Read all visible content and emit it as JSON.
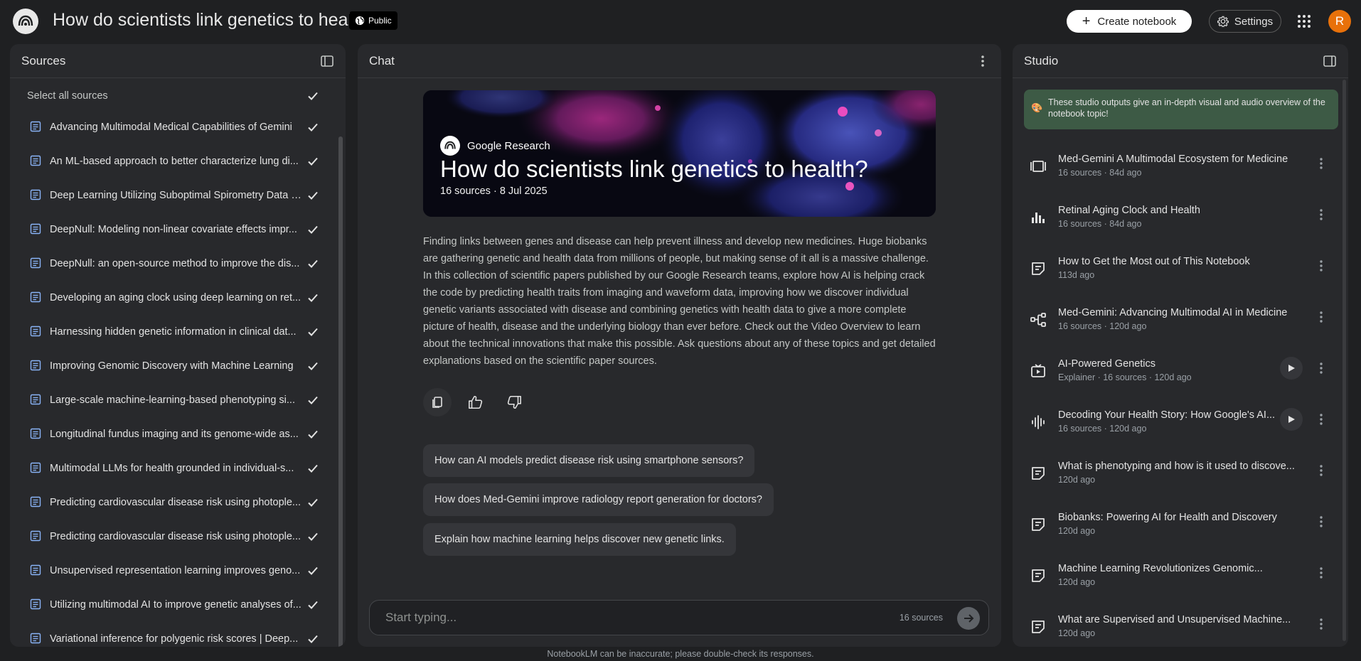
{
  "app": {
    "notebook_title": "How do scientists link genetics to health?",
    "public_label": "Public",
    "create_label": "Create notebook",
    "settings_label": "Settings",
    "avatar_initial": "R"
  },
  "sources": {
    "header": "Sources",
    "select_all": "Select all sources",
    "items": [
      "Advancing Multimodal Medical Capabilities of Gemini",
      "An ML-based approach to better characterize lung di...",
      "Deep Learning Utilizing Suboptimal Spirometry Data t...",
      "DeepNull: Modeling non-linear covariate effects impr...",
      "DeepNull: an open-source method to improve the dis...",
      "Developing an aging clock using deep learning on ret...",
      "Harnessing hidden genetic information in clinical dat...",
      "Improving Genomic Discovery with Machine Learning",
      "Large-scale machine-learning-based phenotyping si...",
      "Longitudinal fundus imaging and its genome-wide as...",
      "Multimodal LLMs for health grounded in individual-s...",
      "Predicting cardiovascular disease risk using photople...",
      "Predicting cardiovascular disease risk using photople...",
      "Unsupervised representation learning improves geno...",
      "Utilizing multimodal AI to improve genetic analyses of...",
      "Variational inference for polygenic risk scores | Deep..."
    ]
  },
  "chat": {
    "header": "Chat",
    "hero_brand": "Google Research",
    "hero_title": "How do scientists link genetics to health?",
    "hero_meta": "16 sources · 8 Jul 2025",
    "summary": "Finding links between genes and disease can help prevent illness and develop new medicines. Huge biobanks are gathering genetic and health data from millions of people, but making sense of it all is a massive challenge. In this collection of scientific papers published by our Google Research teams, explore how AI is helping crack the code by predicting health traits from imaging and waveform data, improving how we discover individual genetic variants associated with disease and combining genetics with health data to give a more complete picture of health, disease and the underlying biology than ever before. Check out the Video Overview to learn about the technical innovations that make this possible. Ask questions about any of these topics and get detailed explanations based on the scientific paper sources.",
    "suggestions": [
      "How can AI models predict disease risk using smartphone sensors?",
      "How does Med-Gemini improve radiology report generation for doctors?",
      "Explain how machine learning helps discover new genetic links."
    ],
    "input_placeholder": "Start typing...",
    "source_count": "16 sources",
    "disclaimer": "NotebookLM can be inaccurate; please double-check its responses."
  },
  "studio": {
    "header": "Studio",
    "banner_emoji": "🎨",
    "banner": "These studio outputs give an in-depth visual and audio overview of the notebook topic!",
    "items": [
      {
        "icon": "slides-icon",
        "title": "Med-Gemini A Multimodal Ecosystem for Medicine",
        "meta": "16 sources · 84d ago",
        "play": false
      },
      {
        "icon": "chart-icon",
        "title": "Retinal Aging Clock and Health",
        "meta": "16 sources · 84d ago",
        "play": false
      },
      {
        "icon": "note-icon",
        "title": "How to Get the Most out of This Notebook",
        "meta": "113d ago",
        "play": false
      },
      {
        "icon": "mindmap-icon",
        "title": "Med-Gemini: Advancing Multimodal AI in Medicine",
        "meta": "16 sources · 120d ago",
        "play": false
      },
      {
        "icon": "video-icon",
        "title": "AI-Powered Genetics",
        "meta": "Explainer · 16 sources · 120d ago",
        "play": true
      },
      {
        "icon": "audio-icon",
        "title": "Decoding Your Health Story: How Google's AI...",
        "meta": "16 sources · 120d ago",
        "play": true
      },
      {
        "icon": "note-icon",
        "title": "What is phenotyping and how is it used to discove...",
        "meta": "120d ago",
        "play": false
      },
      {
        "icon": "note-icon",
        "title": "Biobanks: Powering AI for Health and Discovery",
        "meta": "120d ago",
        "play": false
      },
      {
        "icon": "note-icon",
        "title": "Machine Learning Revolutionizes Genomic...",
        "meta": "120d ago",
        "play": false
      },
      {
        "icon": "note-icon",
        "title": "What are Supervised and Unsupervised Machine...",
        "meta": "120d ago",
        "play": false
      }
    ]
  }
}
